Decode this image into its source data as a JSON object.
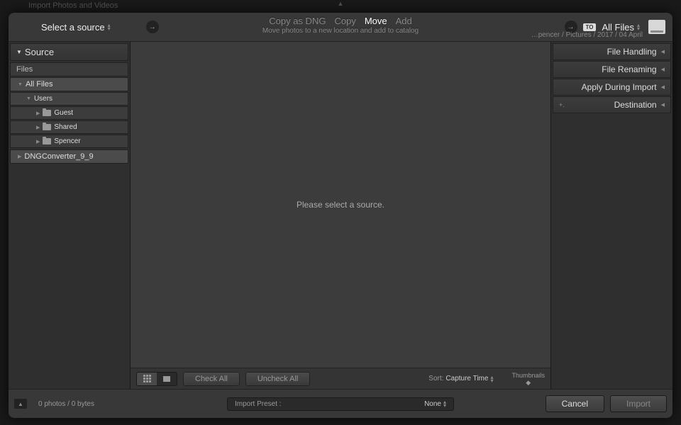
{
  "bg_hint": "Import Photos and Videos",
  "header": {
    "source_label": "Select a source",
    "actions": {
      "copy_dng": "Copy as DNG",
      "copy": "Copy",
      "move": "Move",
      "add": "Add"
    },
    "subtitle": "Move photos to a new location and add to catalog",
    "to_badge": "TO",
    "dest_label": "All Files",
    "dest_path": "…pencer / Pictures / 2017 / 04 April"
  },
  "left": {
    "panel_title": "Source",
    "files_label": "Files",
    "tree": {
      "all_files": "All Files",
      "users": "Users",
      "guest": "Guest",
      "shared": "Shared",
      "spencer": "Spencer",
      "dng": "DNGConverter_9_9"
    }
  },
  "center": {
    "prompt": "Please select a source.",
    "check_all": "Check All",
    "uncheck_all": "Uncheck All",
    "sort_label": "Sort:",
    "sort_value": "Capture Time",
    "thumbnails": "Thumbnails"
  },
  "right": {
    "file_handling": "File Handling",
    "file_renaming": "File Renaming",
    "apply_import": "Apply During Import",
    "destination": "Destination",
    "dest_prefix": "+."
  },
  "footer": {
    "status": "0 photos / 0 bytes",
    "preset_label": "Import Preset :",
    "preset_value": "None",
    "cancel": "Cancel",
    "import": "Import"
  }
}
